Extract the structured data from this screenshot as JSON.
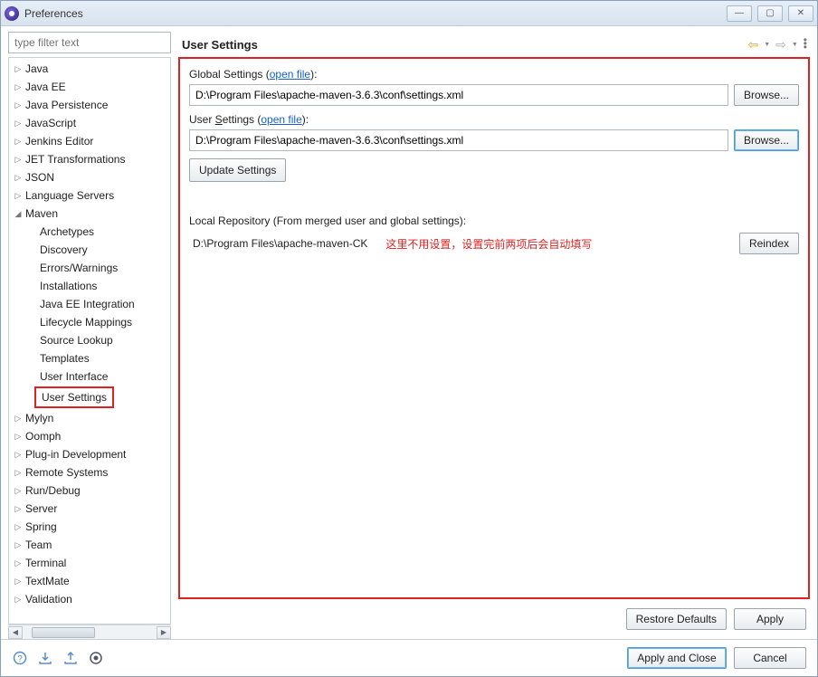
{
  "window": {
    "title": "Preferences"
  },
  "sidebar": {
    "filter_placeholder": "type filter text",
    "items": [
      {
        "label": "Java",
        "depth": 0,
        "expanded": false
      },
      {
        "label": "Java EE",
        "depth": 0,
        "expanded": false
      },
      {
        "label": "Java Persistence",
        "depth": 0,
        "expanded": false
      },
      {
        "label": "JavaScript",
        "depth": 0,
        "expanded": false
      },
      {
        "label": "Jenkins Editor",
        "depth": 0,
        "expanded": false
      },
      {
        "label": "JET Transformations",
        "depth": 0,
        "expanded": false
      },
      {
        "label": "JSON",
        "depth": 0,
        "expanded": false
      },
      {
        "label": "Language Servers",
        "depth": 0,
        "expanded": false
      },
      {
        "label": "Maven",
        "depth": 0,
        "expanded": true
      },
      {
        "label": "Archetypes",
        "depth": 1
      },
      {
        "label": "Discovery",
        "depth": 1
      },
      {
        "label": "Errors/Warnings",
        "depth": 1
      },
      {
        "label": "Installations",
        "depth": 1
      },
      {
        "label": "Java EE Integration",
        "depth": 1
      },
      {
        "label": "Lifecycle Mappings",
        "depth": 1
      },
      {
        "label": "Source Lookup",
        "depth": 1
      },
      {
        "label": "Templates",
        "depth": 1
      },
      {
        "label": "User Interface",
        "depth": 1
      },
      {
        "label": "User Settings",
        "depth": 1,
        "selected": true
      },
      {
        "label": "Mylyn",
        "depth": 0,
        "expanded": false
      },
      {
        "label": "Oomph",
        "depth": 0,
        "expanded": false
      },
      {
        "label": "Plug-in Development",
        "depth": 0,
        "expanded": false
      },
      {
        "label": "Remote Systems",
        "depth": 0,
        "expanded": false
      },
      {
        "label": "Run/Debug",
        "depth": 0,
        "expanded": false
      },
      {
        "label": "Server",
        "depth": 0,
        "expanded": false
      },
      {
        "label": "Spring",
        "depth": 0,
        "expanded": false
      },
      {
        "label": "Team",
        "depth": 0,
        "expanded": false
      },
      {
        "label": "Terminal",
        "depth": 0,
        "expanded": false
      },
      {
        "label": "TextMate",
        "depth": 0,
        "expanded": false
      },
      {
        "label": "Validation",
        "depth": 0,
        "expanded": false
      }
    ]
  },
  "main": {
    "title": "User Settings",
    "global_settings_label_prefix": "Global Settings (",
    "global_settings_link": "open file",
    "global_settings_label_suffix": "):",
    "global_settings_value": "D:\\Program Files\\apache-maven-3.6.3\\conf\\settings.xml",
    "global_browse": "Browse...",
    "user_settings_label_prefix": "User ",
    "user_settings_label_underline": "S",
    "user_settings_label_rest": "ettings (",
    "user_settings_link": "open file",
    "user_settings_label_suffix": "):",
    "user_settings_value": "D:\\Program Files\\apache-maven-3.6.3\\conf\\settings.xml",
    "user_browse": "Browse...",
    "update_settings": "Update Settings",
    "local_repo_label": "Local Repository (From merged user and global settings):",
    "local_repo_value": "D:\\Program Files\\apache-maven-CK",
    "local_repo_annotation": "这里不用设置，设置完前两项后会自动填写",
    "reindex": "Reindex",
    "restore_defaults": "Restore Defaults",
    "apply": "Apply"
  },
  "footer": {
    "apply_close": "Apply and Close",
    "cancel": "Cancel"
  }
}
